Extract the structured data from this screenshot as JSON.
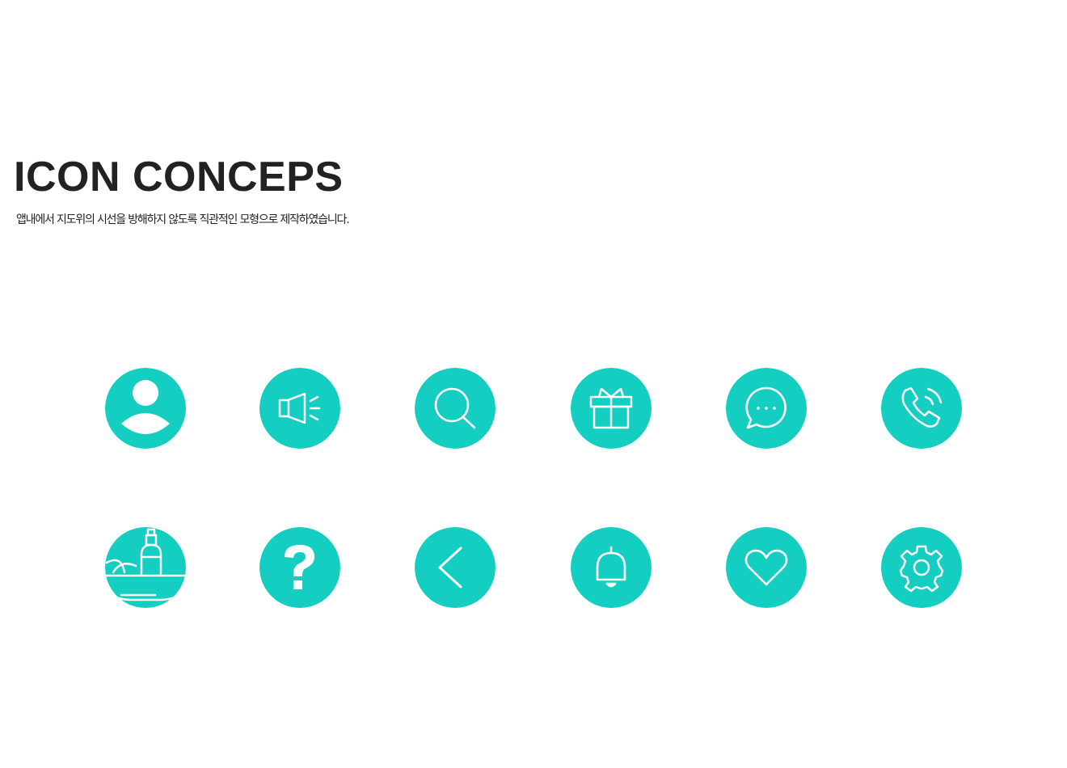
{
  "header": {
    "title": "ICON CONCEPS",
    "subtitle": "앱내에서 지도위의 시선을 방해하지 않도록 직관적인 모형으로 제작하였습니다."
  },
  "theme": {
    "accent": "#13CEC1",
    "icon_stroke": "#FFFFFF",
    "text": "#222222"
  },
  "icons": {
    "row1": [
      "user-icon",
      "megaphone-icon",
      "search-icon",
      "gift-icon",
      "chat-icon",
      "phone-icon"
    ],
    "row2": [
      "salad-bottle-icon",
      "question-icon",
      "back-arrow-icon",
      "bell-icon",
      "heart-icon",
      "settings-icon"
    ]
  }
}
